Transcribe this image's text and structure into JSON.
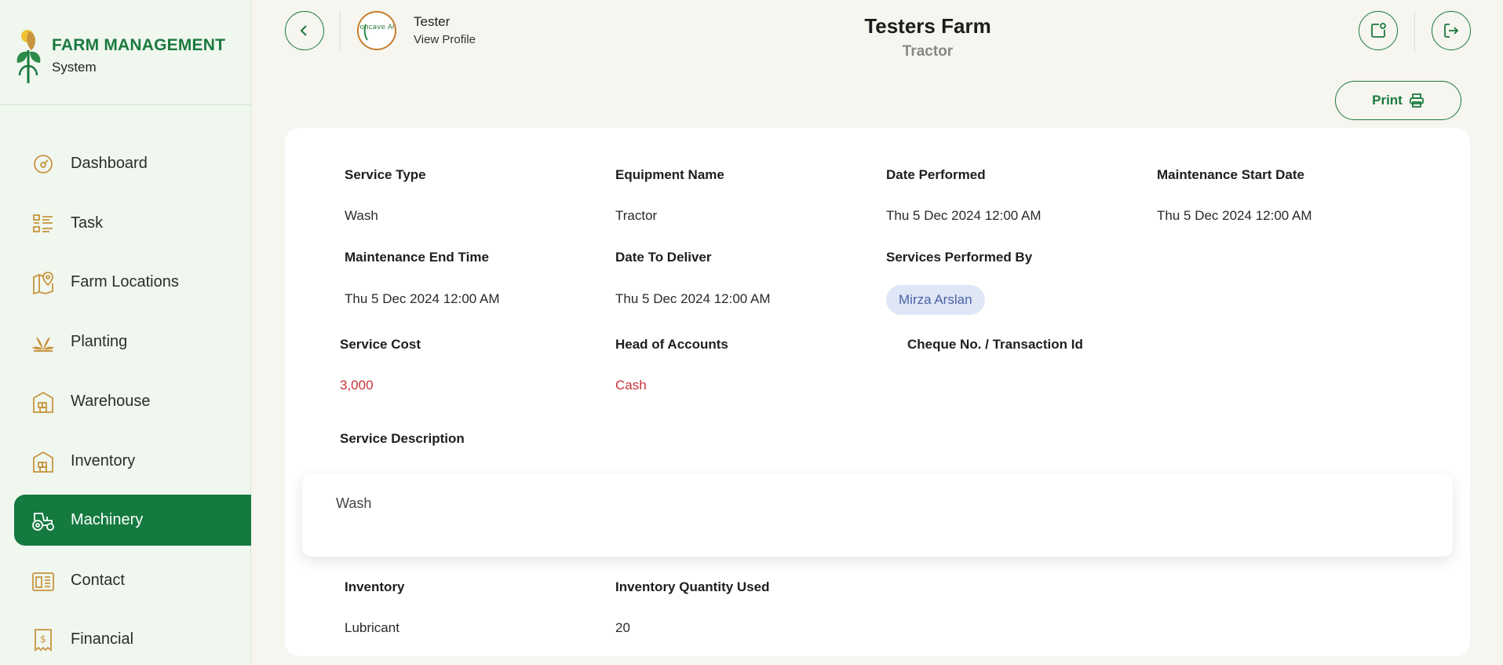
{
  "brand": {
    "title": "FARM MANAGEMENT",
    "subtitle": "System"
  },
  "sidebar": {
    "items": [
      {
        "label": "Dashboard",
        "icon": "dashboard-icon",
        "active": false
      },
      {
        "label": "Task",
        "icon": "task-list-icon",
        "active": false
      },
      {
        "label": "Farm Locations",
        "icon": "map-pin-icon",
        "active": false
      },
      {
        "label": "Planting",
        "icon": "plant-icon",
        "active": false
      },
      {
        "label": "Warehouse",
        "icon": "warehouse-icon",
        "active": false
      },
      {
        "label": "Inventory",
        "icon": "inventory-icon",
        "active": false
      },
      {
        "label": "Machinery",
        "icon": "tractor-icon",
        "active": true
      },
      {
        "label": "Contact",
        "icon": "contact-icon",
        "active": false
      },
      {
        "label": "Financial",
        "icon": "receipt-icon",
        "active": false
      }
    ]
  },
  "header": {
    "user_name": "Tester",
    "view_profile": "View Profile",
    "avatar_text": "Concave AGRI",
    "farm_title": "Testers Farm",
    "farm_subtitle": "Tractor",
    "print_label": "Print"
  },
  "details": {
    "service_type": {
      "label": "Service Type",
      "value": "Wash"
    },
    "equipment_name": {
      "label": "Equipment Name",
      "value": "Tractor"
    },
    "date_performed": {
      "label": "Date Performed",
      "value": "Thu 5 Dec 2024 12:00 AM"
    },
    "maintenance_start": {
      "label": "Maintenance Start Date",
      "value": "Thu 5 Dec 2024 12:00 AM"
    },
    "maintenance_end": {
      "label": "Maintenance End Time",
      "value": "Thu 5 Dec 2024 12:00 AM"
    },
    "date_to_deliver": {
      "label": "Date To Deliver",
      "value": "Thu 5 Dec 2024 12:00 AM"
    },
    "performed_by": {
      "label": "Services Performed By",
      "value": "Mirza Arslan"
    },
    "service_cost": {
      "label": "Service Cost",
      "value": "3,000"
    },
    "head_of_accounts": {
      "label": "Head of Accounts",
      "value": "Cash"
    },
    "cheque": {
      "label": "Cheque No. / Transaction Id",
      "value": ""
    },
    "description": {
      "label": "Service Description",
      "value": "Wash"
    },
    "inventory": {
      "label": "Inventory",
      "value": "Lubricant"
    },
    "inventory_qty": {
      "label": "Inventory Quantity Used",
      "value": "20"
    }
  },
  "colors": {
    "brand_green": "#1a7a3e",
    "sidebar_bg": "#f0f7ef",
    "page_bg": "#f6f5ef",
    "icon_gold": "#c8943f",
    "value_red": "#c8333b",
    "chip_bg": "#dfe6f6",
    "chip_text": "#4a62a6"
  }
}
